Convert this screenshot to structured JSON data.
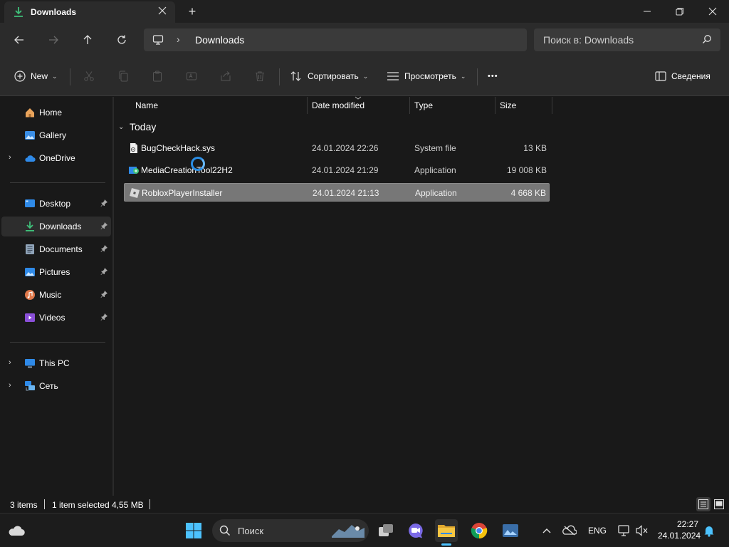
{
  "window": {
    "tab_title": "Downloads",
    "new_tab_symbol": "+"
  },
  "nav": {
    "breadcrumb": "Downloads",
    "search_placeholder": "Поиск в: Downloads"
  },
  "commands": {
    "new_label": "New",
    "sort_label": "Сортировать",
    "view_label": "Просмотреть",
    "more_label": "•••",
    "details_label": "Сведения"
  },
  "sidebar": {
    "items": [
      {
        "label": "Home",
        "icon": "home-icon"
      },
      {
        "label": "Gallery",
        "icon": "gallery-icon"
      },
      {
        "label": "OneDrive",
        "icon": "onedrive-icon"
      },
      {
        "label": "Desktop",
        "icon": "desktop-icon"
      },
      {
        "label": "Downloads",
        "icon": "downloads-icon"
      },
      {
        "label": "Documents",
        "icon": "documents-icon"
      },
      {
        "label": "Pictures",
        "icon": "pictures-icon"
      },
      {
        "label": "Music",
        "icon": "music-icon"
      },
      {
        "label": "Videos",
        "icon": "videos-icon"
      },
      {
        "label": "This PC",
        "icon": "this-pc-icon"
      },
      {
        "label": "Сеть",
        "icon": "network-icon"
      }
    ]
  },
  "columns": {
    "name": "Name",
    "date": "Date modified",
    "type": "Type",
    "size": "Size"
  },
  "group": {
    "label": "Today"
  },
  "files": [
    {
      "name": "BugCheckHack.sys",
      "date": "24.01.2024 22:26",
      "type": "System file",
      "size": "13 KB",
      "icon": "system-file-icon",
      "selected": false
    },
    {
      "name": "MediaCreationTool22H2",
      "date": "24.01.2024 21:29",
      "type": "Application",
      "size": "19 008 KB",
      "icon": "media-creation-tool-icon",
      "selected": false
    },
    {
      "name": "RobloxPlayerInstaller",
      "date": "24.01.2024 21:13",
      "type": "Application",
      "size": "4 668 KB",
      "icon": "roblox-icon",
      "selected": true
    }
  ],
  "status": {
    "items_count": "3 items",
    "selected_text": "1 item selected",
    "selected_size": "4,55 MB"
  },
  "taskbar": {
    "search_label": "Поиск",
    "lang": "ENG",
    "time": "22:27",
    "date": "24.01.2024"
  },
  "colors": {
    "accent": "#4cc2ff",
    "folder": "#f5c542",
    "selection": "#777777"
  }
}
